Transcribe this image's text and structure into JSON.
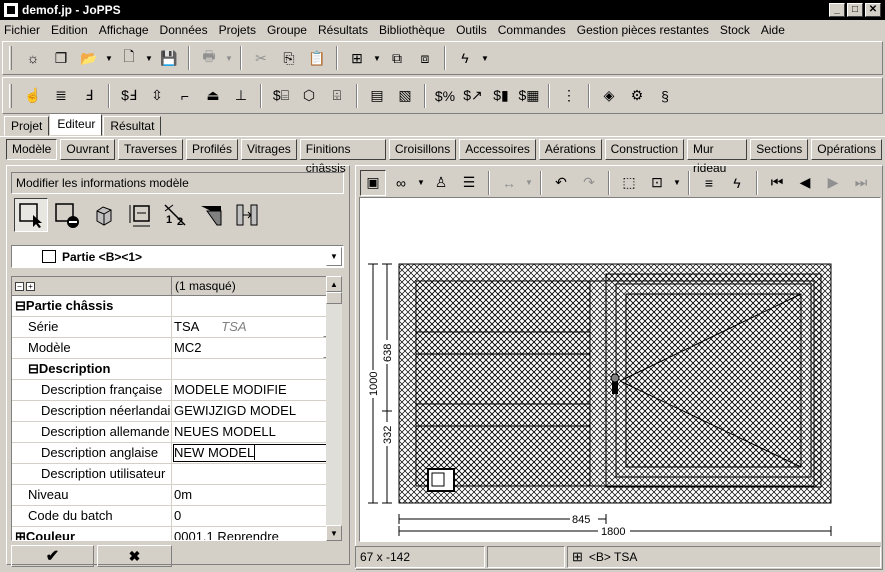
{
  "window": {
    "title": "demof.jp - JoPPS"
  },
  "menu": [
    "Fichier",
    "Edition",
    "Affichage",
    "Données",
    "Projets",
    "Groupe",
    "Résultats",
    "Bibliothèque",
    "Outils",
    "Commandes",
    "Gestion pièces restantes",
    "Stock",
    "Aide"
  ],
  "main_tabs": [
    {
      "label": "Projet"
    },
    {
      "label": "Editeur",
      "active": true
    },
    {
      "label": "Résultat"
    }
  ],
  "sub_tabs": [
    {
      "label": "Modèle",
      "active": true
    },
    {
      "label": "Ouvrant"
    },
    {
      "label": "Traverses"
    },
    {
      "label": "Profilés"
    },
    {
      "label": "Vitrages"
    },
    {
      "label": "Finitions châssis"
    },
    {
      "label": "Croisillons"
    },
    {
      "label": "Accessoires"
    },
    {
      "label": "Aérations"
    },
    {
      "label": "Construction"
    },
    {
      "label": "Mur rideau"
    },
    {
      "label": "Sections"
    },
    {
      "label": "Opérations"
    }
  ],
  "left": {
    "panel_title": "Modifier les informations modèle",
    "part_combo": "Partie <B><1>",
    "grid_header": "(1 masqué)",
    "rows": [
      {
        "key": "⊟Partie châssis",
        "value": "",
        "type": "section",
        "indent": 0
      },
      {
        "key": "Série",
        "value": "TSA",
        "value2": "TSA",
        "ellipsis": true,
        "indent": 1
      },
      {
        "key": "Modèle",
        "value": "MC2",
        "ellipsis": true,
        "indent": 1
      },
      {
        "key": "⊟Description",
        "value": "",
        "type": "section",
        "indent": 1
      },
      {
        "key": "Description française",
        "value": "MODELE MODIFIE",
        "indent": 2
      },
      {
        "key": "Description néerlandaise",
        "value": "GEWIJZIGD MODEL",
        "indent": 2
      },
      {
        "key": "Description allemande",
        "value": "NEUES MODELL",
        "indent": 2
      },
      {
        "key": "Description anglaise",
        "value": "NEW MODEL",
        "editing": true,
        "indent": 2
      },
      {
        "key": "Description utilisateur",
        "value": "",
        "indent": 2
      },
      {
        "key": "Niveau",
        "value": "0m",
        "indent": 1
      },
      {
        "key": "Code du batch",
        "value": "0",
        "indent": 1
      },
      {
        "key": "⊞Couleur",
        "value": "0001.1  Reprendre",
        "type": "section",
        "indent": 0
      }
    ],
    "ok_icon": "check-icon",
    "cancel_icon": "x-icon"
  },
  "drawing": {
    "dims": {
      "total_height": "1000",
      "upper_height": "638",
      "lower_height": "332",
      "left_width": "845",
      "total_width": "1800"
    }
  },
  "status": {
    "coords": "67 x -142",
    "mid": "",
    "profile": "<B> TSA"
  }
}
